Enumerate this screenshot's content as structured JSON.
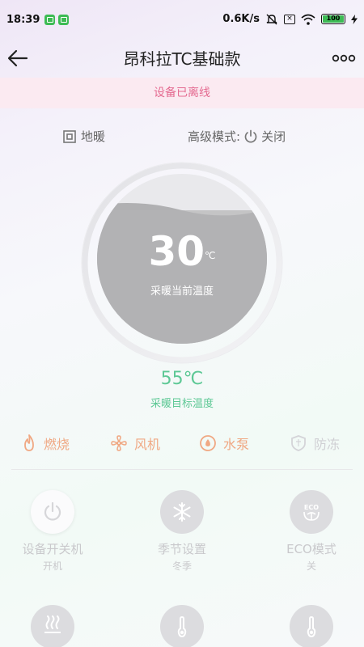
{
  "status_bar": {
    "time": "18:39",
    "net_speed": "0.6K/s",
    "battery": "100"
  },
  "header": {
    "title": "昂科拉TC基础款"
  },
  "banner": {
    "offline_text": "设备已离线"
  },
  "mode": {
    "floor_label": "地暖",
    "advanced_label": "高级模式:",
    "advanced_value": "关闭"
  },
  "current_temp": {
    "value": "30",
    "unit": "℃",
    "caption": "采暖当前温度"
  },
  "target_temp": {
    "value": "55℃",
    "caption": "采暖目标温度"
  },
  "status_items": [
    {
      "label": "燃烧",
      "icon": "flame-icon",
      "color": "#f0a883"
    },
    {
      "label": "风机",
      "icon": "fan-icon",
      "color": "#f0a883"
    },
    {
      "label": "水泵",
      "icon": "pump-icon",
      "color": "#f0a883"
    },
    {
      "label": "防冻",
      "icon": "shield-icon",
      "color": "#d4d4d8"
    }
  ],
  "controls": [
    {
      "label": "设备开关机",
      "value": "开机",
      "icon": "power-icon"
    },
    {
      "label": "季节设置",
      "value": "冬季",
      "icon": "snowflake-icon"
    },
    {
      "label": "ECO模式",
      "value": "关",
      "icon": "eco-icon"
    },
    {
      "icon": "heating-icon"
    },
    {
      "icon": "thermometer-icon"
    },
    {
      "icon": "thermometer-icon"
    }
  ],
  "colors": {
    "accent_green": "#5dc895",
    "warn_pink": "#e46a90",
    "status_orange": "#f0a883"
  }
}
